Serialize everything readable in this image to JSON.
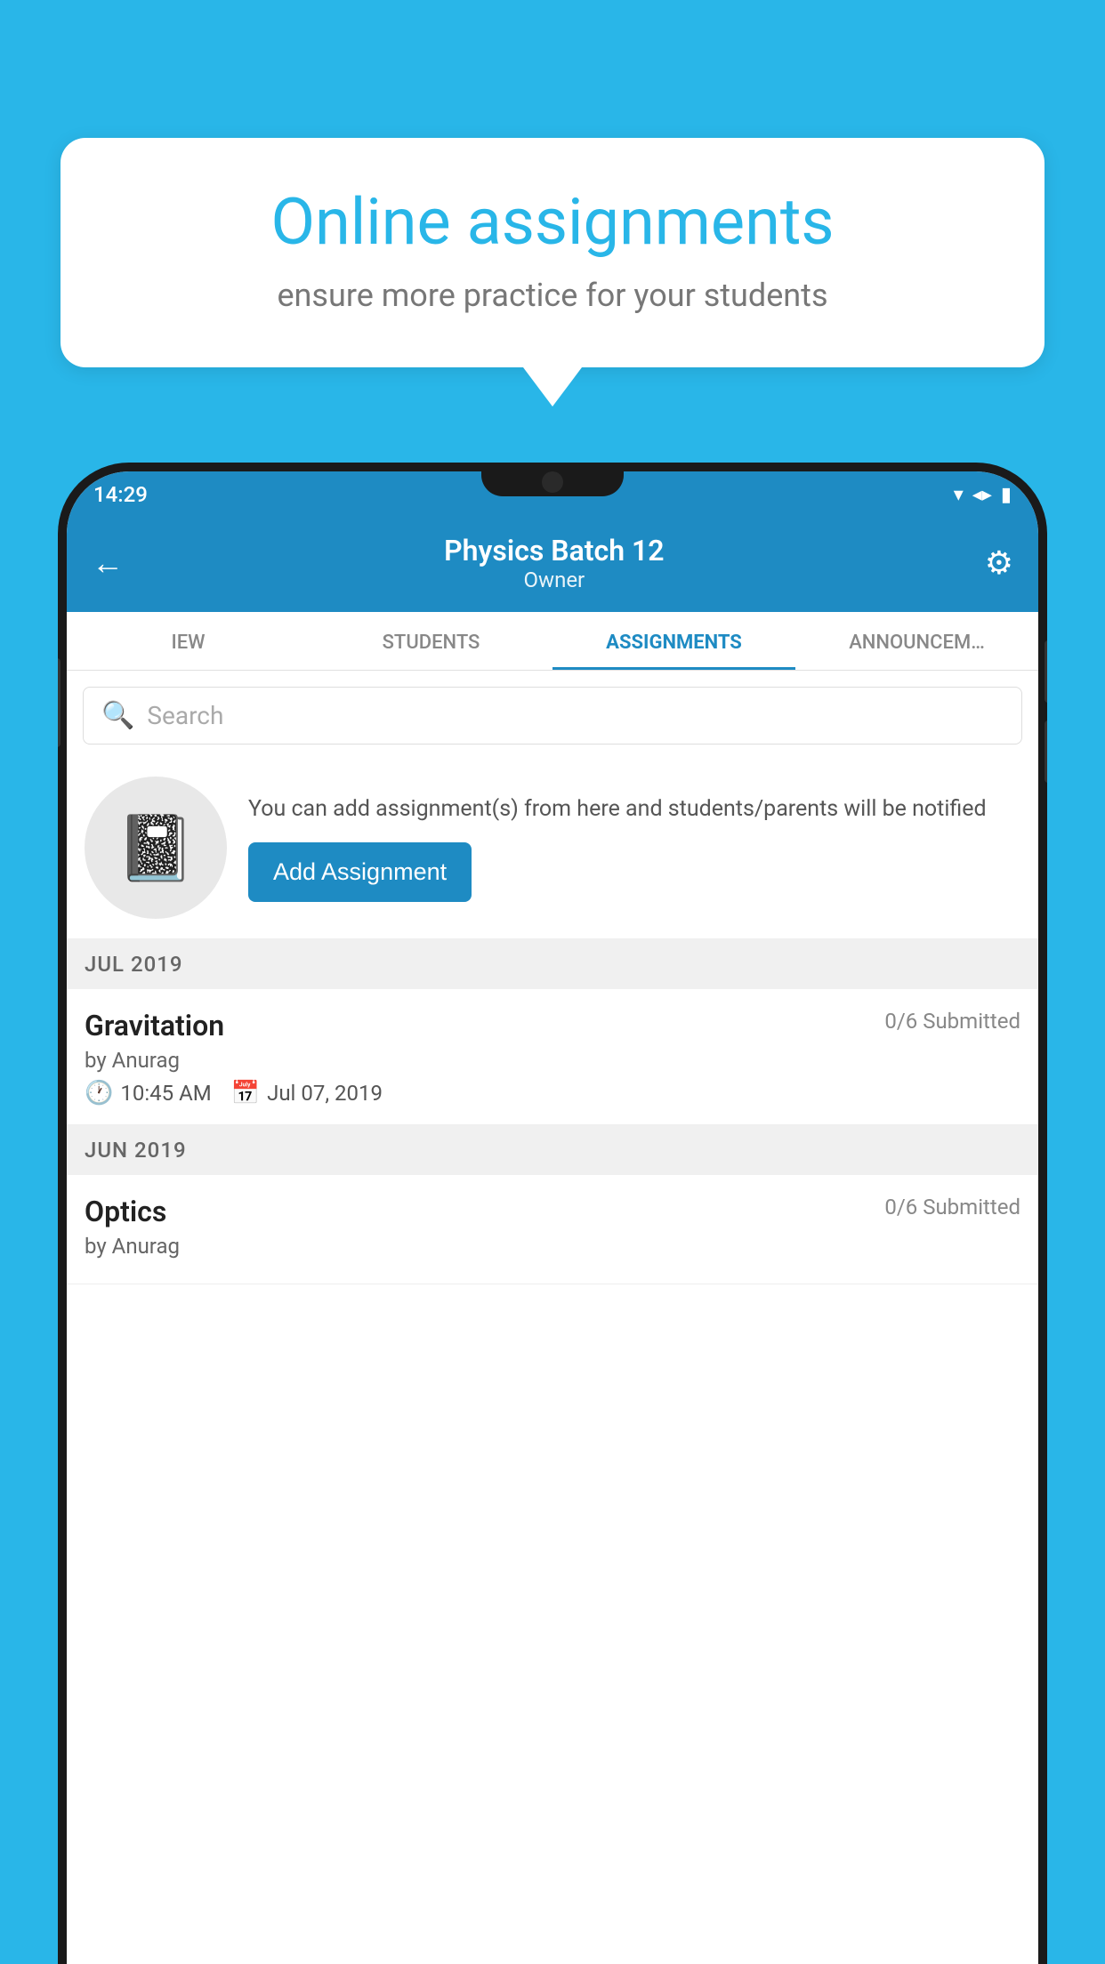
{
  "background_color": "#29b6e8",
  "speech_bubble": {
    "title": "Online assignments",
    "subtitle": "ensure more practice for your students"
  },
  "status_bar": {
    "time": "14:29",
    "icons": [
      "wifi",
      "signal",
      "battery"
    ]
  },
  "app_header": {
    "title": "Physics Batch 12",
    "subtitle": "Owner",
    "back_label": "←",
    "settings_label": "⚙"
  },
  "tabs": [
    {
      "label": "IEW",
      "active": false
    },
    {
      "label": "STUDENTS",
      "active": false
    },
    {
      "label": "ASSIGNMENTS",
      "active": true
    },
    {
      "label": "ANNOUNCEM…",
      "active": false
    }
  ],
  "search": {
    "placeholder": "Search"
  },
  "promo": {
    "description": "You can add assignment(s) from here and students/parents will be notified",
    "button_label": "Add Assignment"
  },
  "sections": [
    {
      "month": "JUL 2019",
      "assignments": [
        {
          "name": "Gravitation",
          "submitted": "0/6 Submitted",
          "by": "by Anurag",
          "time": "10:45 AM",
          "date": "Jul 07, 2019"
        }
      ]
    },
    {
      "month": "JUN 2019",
      "assignments": [
        {
          "name": "Optics",
          "submitted": "0/6 Submitted",
          "by": "by Anurag",
          "time": "",
          "date": ""
        }
      ]
    }
  ]
}
